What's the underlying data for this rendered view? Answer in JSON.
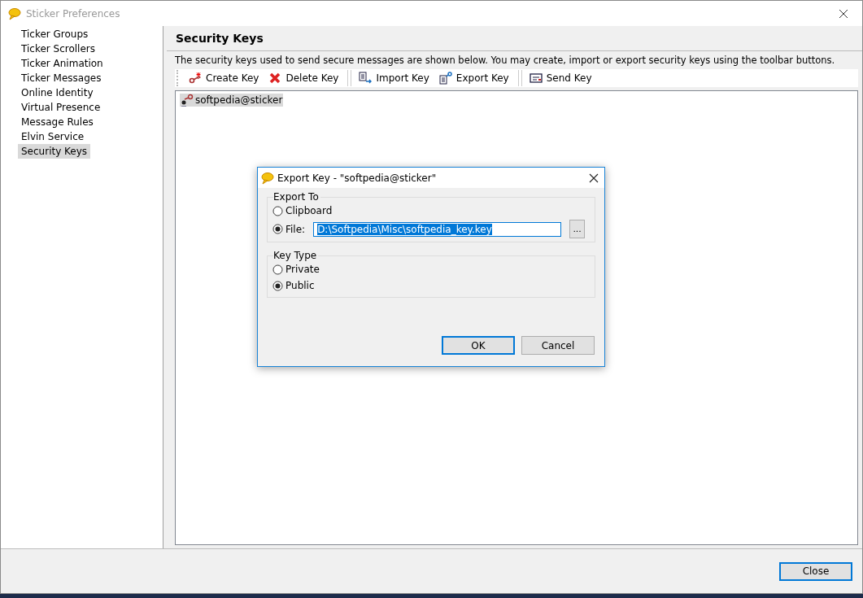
{
  "window": {
    "title": "Sticker Preferences"
  },
  "sidebar": {
    "items": [
      {
        "label": "Ticker Groups",
        "selected": false
      },
      {
        "label": "Ticker Scrollers",
        "selected": false
      },
      {
        "label": "Ticker Animation",
        "selected": false
      },
      {
        "label": "Ticker Messages",
        "selected": false
      },
      {
        "label": "Online Identity",
        "selected": false
      },
      {
        "label": "Virtual Presence",
        "selected": false
      },
      {
        "label": "Message Rules",
        "selected": false
      },
      {
        "label": "Elvin Service",
        "selected": false
      },
      {
        "label": "Security Keys",
        "selected": true
      }
    ]
  },
  "panel": {
    "title": "Security Keys",
    "description": "The security keys used to send secure messages are shown below. You may create, import or export security keys using the toolbar buttons.",
    "toolbar": {
      "groups": [
        [
          {
            "label": "Create Key"
          },
          {
            "label": "Delete Key"
          }
        ],
        [
          {
            "label": "Import Key"
          },
          {
            "label": "Export Key"
          }
        ],
        [
          {
            "label": "Send Key"
          }
        ]
      ]
    },
    "key_list": {
      "items": [
        {
          "label": "softpedia@sticker",
          "selected": true
        }
      ]
    }
  },
  "dialog": {
    "title": "Export Key - \"softpedia@sticker\"",
    "export_to": {
      "legend": "Export To",
      "options": [
        {
          "label": "Clipboard",
          "selected": false
        },
        {
          "label": "File:",
          "selected": true
        }
      ],
      "file_path": "D:\\Softpedia\\Misc\\softpedia_key.key",
      "browse_button": "..."
    },
    "key_type": {
      "legend": "Key Type",
      "options": [
        {
          "label": "Private",
          "selected": false
        },
        {
          "label": "Public",
          "selected": true
        }
      ]
    },
    "buttons": [
      {
        "label": "OK",
        "default": true
      },
      {
        "label": "Cancel",
        "default": false
      }
    ]
  },
  "footer": {
    "close_button": "Close"
  }
}
